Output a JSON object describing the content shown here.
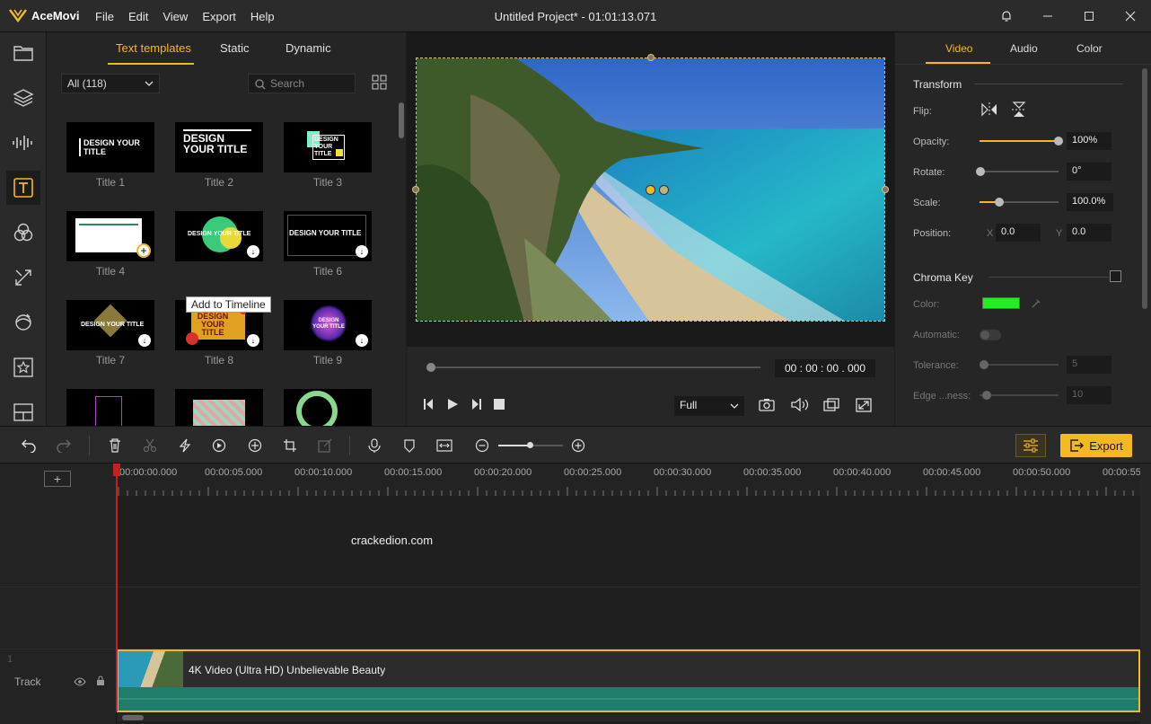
{
  "app": {
    "name": "AceMovi",
    "window_title": "Untitled Project* - 01:01:13.071"
  },
  "menu": [
    "File",
    "Edit",
    "View",
    "Export",
    "Help"
  ],
  "templates": {
    "tabs": [
      "Text templates",
      "Static",
      "Dynamic"
    ],
    "filter_value": "All (118)",
    "search_placeholder": "Search",
    "tooltip": "Add to Timeline",
    "items": [
      {
        "caption": "Title 1",
        "text": "DESIGN YOUR TITLE"
      },
      {
        "caption": "Title 2",
        "text": "DESIGN YOUR TITLE"
      },
      {
        "caption": "Title 3",
        "text": "DESIGN YOUR TITLE"
      },
      {
        "caption": "Title 4",
        "text": ""
      },
      {
        "caption": "",
        "text": "DESIGN YOUR TITLE"
      },
      {
        "caption": "Title 6",
        "text": "DESIGN YOUR TITLE"
      },
      {
        "caption": "Title 7",
        "text": "DESIGN YOUR TITLE"
      },
      {
        "caption": "Title 8",
        "text": "DESIGN YOUR TITLE"
      },
      {
        "caption": "Title 9",
        "text": "DESIGN YOUR TITLE"
      }
    ]
  },
  "preview": {
    "timecode": "00 : 00 : 00 . 000",
    "zoom": "Full",
    "progress": 0
  },
  "props": {
    "tabs": [
      "Video",
      "Audio",
      "Color"
    ],
    "transform": "Transform",
    "flip_label": "Flip:",
    "opacity_label": "Opacity:",
    "opacity_value": "100%",
    "opacity": 1.0,
    "rotate_label": "Rotate:",
    "rotate_value": "0°",
    "rotate": 0,
    "scale_label": "Scale:",
    "scale_value": "100.0%",
    "scale": 0.25,
    "position_label": "Position:",
    "pos_x_label": "X",
    "pos_x": "0.0",
    "pos_y_label": "Y",
    "pos_y": "0.0",
    "chroma": "Chroma Key",
    "color_label": "Color:",
    "chroma_color": "#22ee22",
    "automatic_label": "Automatic:",
    "tolerance_label": "Tolerance:",
    "tolerance_value": "5",
    "edge_label": "Edge ...ness:",
    "edge_value": "10"
  },
  "toolbar": {
    "export_label": "Export"
  },
  "timeline": {
    "ticks": [
      "00:00:00.000",
      "00:00:05.000",
      "00:00:10.000",
      "00:00:15.000",
      "00:00:20.000",
      "00:00:25.000",
      "00:00:30.000",
      "00:00:35.000",
      "00:00:40.000",
      "00:00:45.000",
      "00:00:50.000",
      "00:00:55"
    ],
    "watermark": "crackedion.com",
    "track_number": "1",
    "track_label": "Track",
    "clip_title": "4K Video (Ultra HD) Unbelievable Beauty"
  },
  "colors": {
    "accent": "#f4b822",
    "wave": "#1f7d69"
  }
}
